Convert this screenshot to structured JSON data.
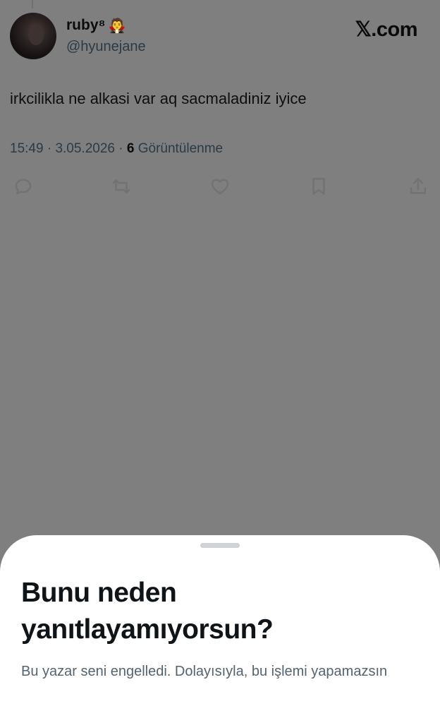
{
  "tweet": {
    "author": {
      "display_name": "ruby⁸",
      "name_emoji": "🧛",
      "handle": "@hyunejane",
      "avatar_icon": "avatar-photo"
    },
    "brand": "𝕏.com",
    "text": "irkcilikla ne alkasi var aq sacmaladiniz iyice",
    "meta": {
      "time": "15:49",
      "date": "3.05.2026",
      "separator": "·",
      "views_count": "6",
      "views_label": "Görüntülenme"
    },
    "actions": [
      {
        "name": "reply",
        "icon": "reply-icon"
      },
      {
        "name": "retweet",
        "icon": "retweet-icon"
      },
      {
        "name": "like",
        "icon": "heart-icon"
      },
      {
        "name": "bookmark",
        "icon": "bookmark-icon"
      },
      {
        "name": "share",
        "icon": "share-icon"
      }
    ]
  },
  "sheet": {
    "title": "Bunu neden yanıtlayamıyorsun?",
    "body": "Bu yazar seni engelledi. Dolayısıyla, bu işlemi yapamazsın"
  },
  "colors": {
    "overlay_bg": "#7f7f7f",
    "sheet_bg": "#ffffff",
    "title_color": "#0f1419",
    "body_color": "#536471"
  }
}
